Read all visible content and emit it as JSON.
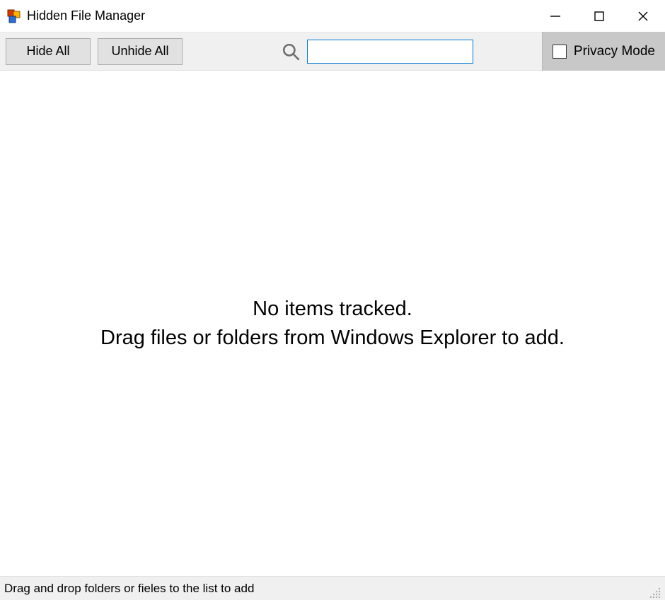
{
  "titlebar": {
    "title": "Hidden File Manager"
  },
  "toolbar": {
    "hide_all_label": "Hide All",
    "unhide_all_label": "Unhide All",
    "search_value": "",
    "search_placeholder": "",
    "privacy_mode_label": "Privacy Mode",
    "privacy_mode_checked": false
  },
  "main": {
    "empty_line1": "No items tracked.",
    "empty_line2": "Drag files or folders from Windows Explorer to add."
  },
  "statusbar": {
    "text": "Drag and drop folders or fieles to the list to add"
  },
  "icons": {
    "app": "app-icon",
    "search": "search-icon",
    "minimize": "minimize-icon",
    "maximize": "maximize-icon",
    "close": "close-icon",
    "resize_grip": "resize-grip-icon"
  }
}
